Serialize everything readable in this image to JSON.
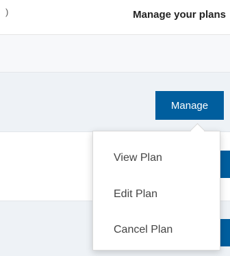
{
  "header": {
    "left_fragment": ")",
    "title": "Manage your plans"
  },
  "manage_button": {
    "label": "Manage"
  },
  "dropdown": {
    "items": [
      {
        "label": "View Plan"
      },
      {
        "label": "Edit Plan"
      },
      {
        "label": "Cancel Plan"
      }
    ]
  },
  "colors": {
    "primary_button": "#005e9e",
    "row_shaded": "#eef2f6"
  }
}
